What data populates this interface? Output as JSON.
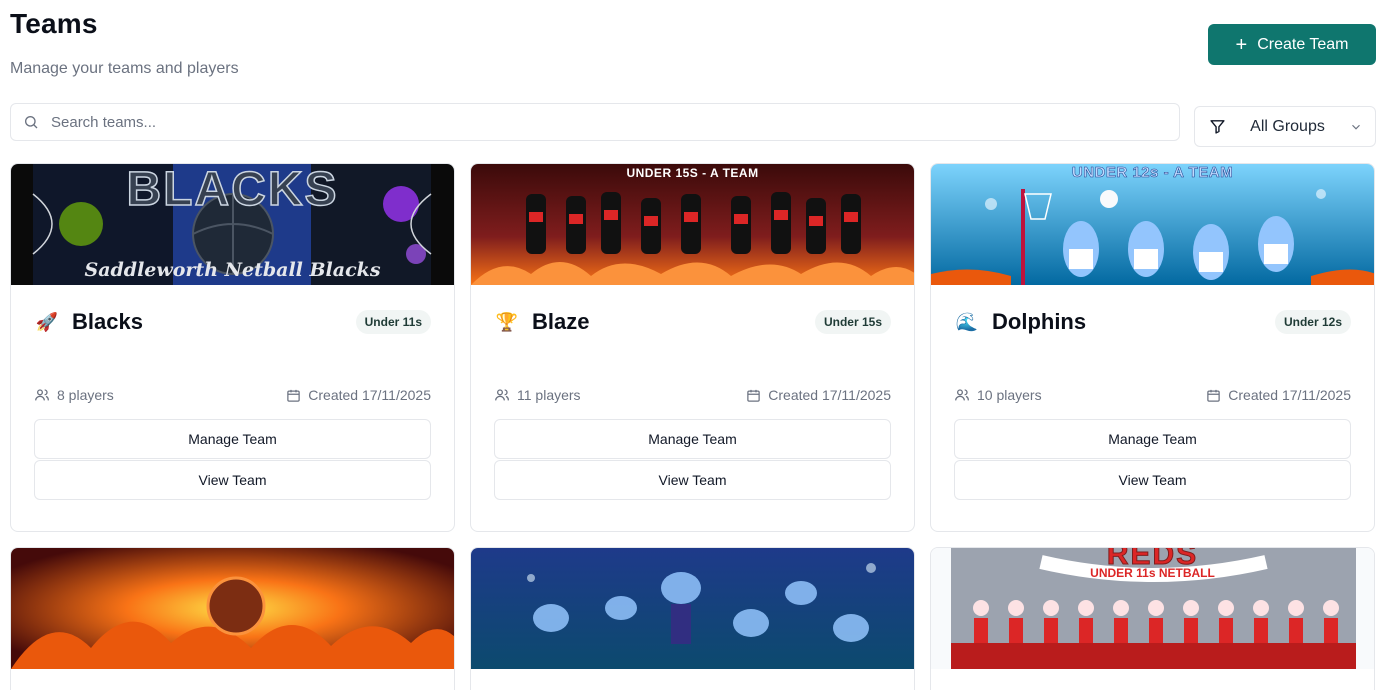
{
  "header": {
    "title": "Teams",
    "subtitle": "Manage your teams and players",
    "create_label": "Create Team"
  },
  "search": {
    "placeholder": "Search teams..."
  },
  "filter": {
    "selected": "All Groups"
  },
  "colors": {
    "accent": "#0f766e",
    "border": "#e5e7eb",
    "muted": "#6b7280"
  },
  "teams": [
    {
      "name": "Blacks",
      "emoji": "🚀",
      "group": "Under 11s",
      "players": "8 players",
      "created": "Created 17/11/2025",
      "banner_text": "Saddleworth Netball Blacks",
      "banner_logo": "BLACKS",
      "manage_label": "Manage Team",
      "view_label": "View Team"
    },
    {
      "name": "Blaze",
      "emoji": "🏆",
      "group": "Under 15s",
      "players": "11 players",
      "created": "Created 17/11/2025",
      "banner_text": "UNDER 15S - A TEAM",
      "manage_label": "Manage Team",
      "view_label": "View Team"
    },
    {
      "name": "Dolphins",
      "emoji": "🌊",
      "group": "Under 12s",
      "players": "10 players",
      "created": "Created 17/11/2025",
      "banner_text": "UNDER 12s - A TEAM",
      "manage_label": "Manage Team",
      "view_label": "View Team"
    }
  ],
  "more_teams": [
    {
      "banner_text": ""
    },
    {
      "banner_text": ""
    },
    {
      "banner_text": "UNDER 11s NETBALL",
      "banner_logo": "REDS"
    }
  ]
}
